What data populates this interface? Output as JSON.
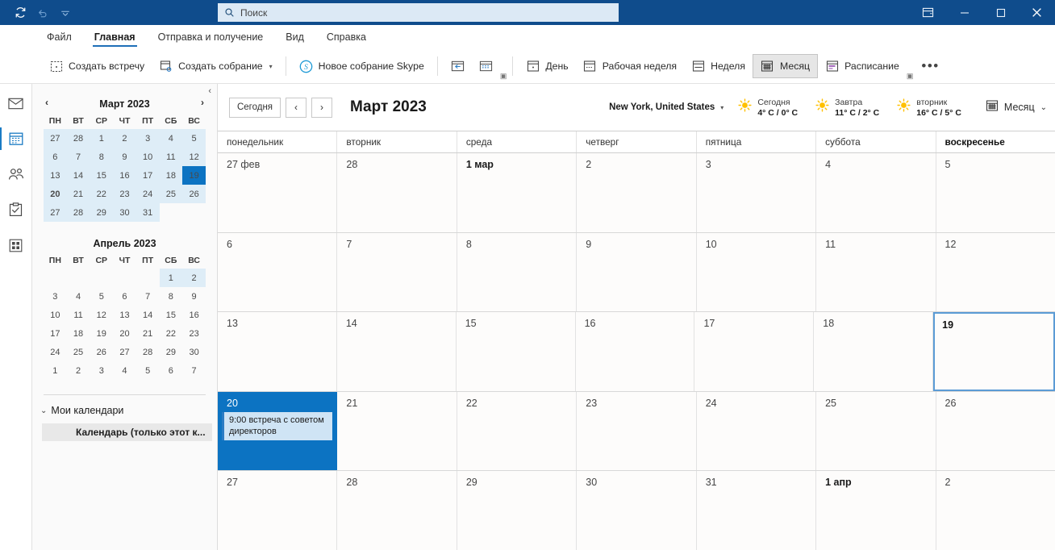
{
  "titlebar": {
    "qat": [
      {
        "name": "sync-icon",
        "label": "Синхронизация"
      },
      {
        "name": "undo-icon",
        "label": "Отменить"
      },
      {
        "name": "customize-qat-icon",
        "label": "Настройка панели быстрого доступа"
      }
    ],
    "search": {
      "placeholder": "Поиск",
      "icon": "search-icon"
    },
    "controls": [
      {
        "name": "ribbon-display-options-icon",
        "label": "Параметры отображения ленты"
      },
      {
        "name": "minimize-icon",
        "label": "Свернуть"
      },
      {
        "name": "maximize-icon",
        "label": "Развернуть"
      },
      {
        "name": "close-icon",
        "label": "Закрыть"
      }
    ],
    "accent": "#0f4c8c"
  },
  "menu": {
    "tabs": [
      {
        "label": "Файл",
        "active": false
      },
      {
        "label": "Главная",
        "active": true
      },
      {
        "label": "Отправка и получение",
        "active": false
      },
      {
        "label": "Вид",
        "active": false
      },
      {
        "label": "Справка",
        "active": false
      }
    ]
  },
  "ribbon": {
    "groups": [
      {
        "label": "Создать встречу",
        "icon": "new-appointment-icon",
        "caret": false,
        "selected": false
      },
      {
        "label": "Создать собрание",
        "icon": "new-meeting-icon",
        "caret": true,
        "selected": false
      },
      {
        "label": "Новое собрание Skype",
        "icon": "skype-icon",
        "caret": false,
        "selected": false
      },
      {
        "label": "",
        "icon": "previous-appointment-icon",
        "caret": false,
        "selected": false
      },
      {
        "label": "",
        "icon": "today-calendar-icon",
        "caret": false,
        "selected": false
      },
      {
        "label": "День",
        "icon": "day-view-icon",
        "caret": false,
        "selected": false
      },
      {
        "label": "Рабочая неделя",
        "icon": "work-week-view-icon",
        "caret": false,
        "selected": false
      },
      {
        "label": "Неделя",
        "icon": "week-view-icon",
        "caret": false,
        "selected": false
      },
      {
        "label": "Месяц",
        "icon": "month-view-icon",
        "caret": false,
        "selected": true
      },
      {
        "label": "Расписание",
        "icon": "schedule-view-icon",
        "caret": false,
        "selected": false
      }
    ],
    "overflow": "•••"
  },
  "leftnav": {
    "items": [
      {
        "name": "mail-icon",
        "label": "Почта",
        "active": false
      },
      {
        "name": "calendar-icon",
        "label": "Календарь",
        "active": true
      },
      {
        "name": "people-icon",
        "label": "Люди",
        "active": false
      },
      {
        "name": "tasks-icon",
        "label": "Задачи",
        "active": false
      },
      {
        "name": "more-apps-icon",
        "label": "Дополнительно",
        "active": false
      }
    ]
  },
  "sidebar": {
    "collapse_icon": "chevron-left-icon",
    "minicalendars": [
      {
        "title": "Март 2023",
        "prev": "‹",
        "next": "›",
        "dow": [
          "ПН",
          "ВТ",
          "СР",
          "ЧТ",
          "ПТ",
          "СБ",
          "ВС"
        ],
        "weeks": [
          [
            {
              "d": "27",
              "s": "inrange"
            },
            {
              "d": "28",
              "s": "inrange"
            },
            {
              "d": "1",
              "s": "inrange"
            },
            {
              "d": "2",
              "s": "inrange"
            },
            {
              "d": "3",
              "s": "inrange"
            },
            {
              "d": "4",
              "s": "inrange"
            },
            {
              "d": "5",
              "s": "inrange"
            }
          ],
          [
            {
              "d": "6",
              "s": "inrange"
            },
            {
              "d": "7",
              "s": "inrange"
            },
            {
              "d": "8",
              "s": "inrange"
            },
            {
              "d": "9",
              "s": "inrange"
            },
            {
              "d": "10",
              "s": "inrange"
            },
            {
              "d": "11",
              "s": "inrange"
            },
            {
              "d": "12",
              "s": "inrange"
            }
          ],
          [
            {
              "d": "13",
              "s": "inrange"
            },
            {
              "d": "14",
              "s": "inrange"
            },
            {
              "d": "15",
              "s": "inrange"
            },
            {
              "d": "16",
              "s": "inrange"
            },
            {
              "d": "17",
              "s": "inrange"
            },
            {
              "d": "18",
              "s": "inrange"
            },
            {
              "d": "19",
              "s": "today"
            }
          ],
          [
            {
              "d": "20",
              "s": "inrange boldday"
            },
            {
              "d": "21",
              "s": "inrange"
            },
            {
              "d": "22",
              "s": "inrange"
            },
            {
              "d": "23",
              "s": "inrange"
            },
            {
              "d": "24",
              "s": "inrange"
            },
            {
              "d": "25",
              "s": "inrange"
            },
            {
              "d": "26",
              "s": "inrange"
            }
          ],
          [
            {
              "d": "27",
              "s": "inrange"
            },
            {
              "d": "28",
              "s": "inrange"
            },
            {
              "d": "29",
              "s": "inrange"
            },
            {
              "d": "30",
              "s": "inrange"
            },
            {
              "d": "31",
              "s": "inrange"
            },
            {
              "d": "",
              "s": ""
            },
            {
              "d": "",
              "s": ""
            }
          ]
        ]
      },
      {
        "title": "Апрель 2023",
        "prev": "",
        "next": "",
        "dow": [
          "ПН",
          "ВТ",
          "СР",
          "ЧТ",
          "ПТ",
          "СБ",
          "ВС"
        ],
        "weeks": [
          [
            {
              "d": "",
              "s": ""
            },
            {
              "d": "",
              "s": ""
            },
            {
              "d": "",
              "s": ""
            },
            {
              "d": "",
              "s": ""
            },
            {
              "d": "",
              "s": ""
            },
            {
              "d": "1",
              "s": "inrange"
            },
            {
              "d": "2",
              "s": "inrange"
            }
          ],
          [
            {
              "d": "3",
              "s": ""
            },
            {
              "d": "4",
              "s": ""
            },
            {
              "d": "5",
              "s": ""
            },
            {
              "d": "6",
              "s": ""
            },
            {
              "d": "7",
              "s": ""
            },
            {
              "d": "8",
              "s": ""
            },
            {
              "d": "9",
              "s": ""
            }
          ],
          [
            {
              "d": "10",
              "s": ""
            },
            {
              "d": "11",
              "s": ""
            },
            {
              "d": "12",
              "s": ""
            },
            {
              "d": "13",
              "s": ""
            },
            {
              "d": "14",
              "s": ""
            },
            {
              "d": "15",
              "s": ""
            },
            {
              "d": "16",
              "s": ""
            }
          ],
          [
            {
              "d": "17",
              "s": ""
            },
            {
              "d": "18",
              "s": ""
            },
            {
              "d": "19",
              "s": ""
            },
            {
              "d": "20",
              "s": ""
            },
            {
              "d": "21",
              "s": ""
            },
            {
              "d": "22",
              "s": ""
            },
            {
              "d": "23",
              "s": ""
            }
          ],
          [
            {
              "d": "24",
              "s": ""
            },
            {
              "d": "25",
              "s": ""
            },
            {
              "d": "26",
              "s": ""
            },
            {
              "d": "27",
              "s": ""
            },
            {
              "d": "28",
              "s": ""
            },
            {
              "d": "29",
              "s": ""
            },
            {
              "d": "30",
              "s": ""
            }
          ],
          [
            {
              "d": "1",
              "s": "dim"
            },
            {
              "d": "2",
              "s": "dim"
            },
            {
              "d": "3",
              "s": "dim"
            },
            {
              "d": "4",
              "s": "dim"
            },
            {
              "d": "5",
              "s": "dim"
            },
            {
              "d": "6",
              "s": "dim"
            },
            {
              "d": "7",
              "s": "dim"
            }
          ]
        ]
      }
    ],
    "group_label": "Мои календари",
    "calendar_item": "Календарь (только этот к..."
  },
  "calendar": {
    "today_button": "Сегодня",
    "prev_arrow": "‹",
    "next_arrow": "›",
    "title": "Март 2023",
    "location": "New York, United States",
    "weather": [
      {
        "day": "Сегодня",
        "temp": "4° C / 0° C",
        "icon": "sun-icon"
      },
      {
        "day": "Завтра",
        "temp": "11° C / 2° C",
        "icon": "sun-icon"
      },
      {
        "day": "вторник",
        "temp": "16° C / 5° C",
        "icon": "sun-icon"
      }
    ],
    "view_label": "Месяц",
    "view_icon": "month-view-icon",
    "dow": [
      {
        "label": "понедельник",
        "today": false
      },
      {
        "label": "вторник",
        "today": false
      },
      {
        "label": "среда",
        "today": false
      },
      {
        "label": "четверг",
        "today": false
      },
      {
        "label": "пятница",
        "today": false
      },
      {
        "label": "суббота",
        "today": false
      },
      {
        "label": "воскресенье",
        "today": true
      }
    ],
    "weeks": [
      [
        {
          "num": "27 фев",
          "bold": false,
          "state": "",
          "events": []
        },
        {
          "num": "28",
          "bold": false,
          "state": "",
          "events": []
        },
        {
          "num": "1 мар",
          "bold": true,
          "state": "",
          "events": []
        },
        {
          "num": "2",
          "bold": false,
          "state": "",
          "events": []
        },
        {
          "num": "3",
          "bold": false,
          "state": "",
          "events": []
        },
        {
          "num": "4",
          "bold": false,
          "state": "",
          "events": []
        },
        {
          "num": "5",
          "bold": false,
          "state": "",
          "events": []
        }
      ],
      [
        {
          "num": "6",
          "bold": false,
          "state": "",
          "events": []
        },
        {
          "num": "7",
          "bold": false,
          "state": "",
          "events": []
        },
        {
          "num": "8",
          "bold": false,
          "state": "",
          "events": []
        },
        {
          "num": "9",
          "bold": false,
          "state": "",
          "events": []
        },
        {
          "num": "10",
          "bold": false,
          "state": "",
          "events": []
        },
        {
          "num": "11",
          "bold": false,
          "state": "",
          "events": []
        },
        {
          "num": "12",
          "bold": false,
          "state": "",
          "events": []
        }
      ],
      [
        {
          "num": "13",
          "bold": false,
          "state": "",
          "events": []
        },
        {
          "num": "14",
          "bold": false,
          "state": "",
          "events": []
        },
        {
          "num": "15",
          "bold": false,
          "state": "",
          "events": []
        },
        {
          "num": "16",
          "bold": false,
          "state": "",
          "events": []
        },
        {
          "num": "17",
          "bold": false,
          "state": "",
          "events": []
        },
        {
          "num": "18",
          "bold": false,
          "state": "",
          "events": []
        },
        {
          "num": "19",
          "bold": true,
          "state": "todaycell",
          "events": []
        }
      ],
      [
        {
          "num": "20",
          "bold": false,
          "state": "selected",
          "events": [
            "9:00 встреча с советом директоров"
          ]
        },
        {
          "num": "21",
          "bold": false,
          "state": "",
          "events": []
        },
        {
          "num": "22",
          "bold": false,
          "state": "",
          "events": []
        },
        {
          "num": "23",
          "bold": false,
          "state": "",
          "events": []
        },
        {
          "num": "24",
          "bold": false,
          "state": "",
          "events": []
        },
        {
          "num": "25",
          "bold": false,
          "state": "",
          "events": []
        },
        {
          "num": "26",
          "bold": false,
          "state": "",
          "events": []
        }
      ],
      [
        {
          "num": "27",
          "bold": false,
          "state": "",
          "events": []
        },
        {
          "num": "28",
          "bold": false,
          "state": "",
          "events": []
        },
        {
          "num": "29",
          "bold": false,
          "state": "",
          "events": []
        },
        {
          "num": "30",
          "bold": false,
          "state": "",
          "events": []
        },
        {
          "num": "31",
          "bold": false,
          "state": "",
          "events": []
        },
        {
          "num": "1 апр",
          "bold": true,
          "state": "",
          "events": []
        },
        {
          "num": "2",
          "bold": false,
          "state": "",
          "events": []
        }
      ]
    ],
    "colors": {
      "selected": "#0c73c2",
      "today_border": "#5b9bd5",
      "event_bg": "#cfe4f5",
      "event_bar": "#2b7cc4"
    }
  }
}
